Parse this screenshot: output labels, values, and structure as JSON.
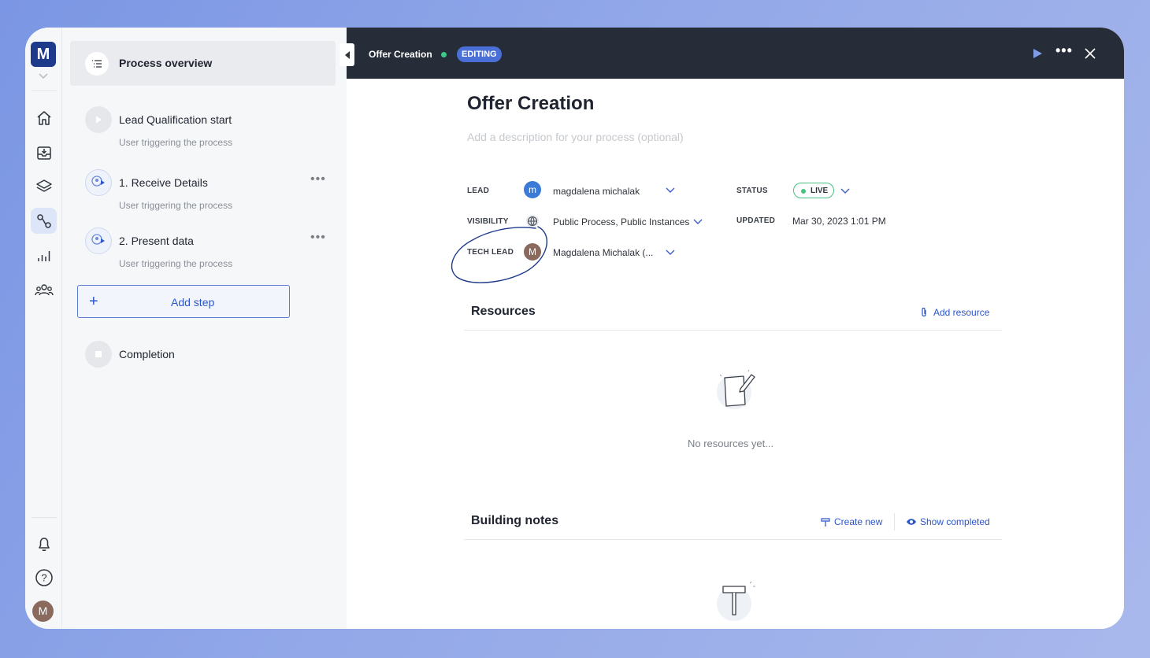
{
  "rail": {
    "logo_letter": "M",
    "avatar_letter": "M",
    "icons": [
      "home-icon",
      "inbox-icon",
      "layers-icon",
      "process-icon",
      "analytics-icon",
      "team-icon",
      "bell-icon",
      "help-icon"
    ]
  },
  "steps_panel": {
    "overview_label": "Process overview",
    "steps": [
      {
        "title": "Lead Qualification start",
        "subtitle": "User triggering the process"
      },
      {
        "title": "1. Receive Details",
        "subtitle": "User triggering the process",
        "more": "•••"
      },
      {
        "title": "2. Present data",
        "subtitle": "User triggering the process",
        "more": "•••"
      }
    ],
    "add_step_label": "Add step",
    "add_step_plus": "+",
    "completion_label": "Completion"
  },
  "topbar": {
    "title": "Offer Creation",
    "badge": "EDITING",
    "more": "•••"
  },
  "process": {
    "title": "Offer Creation",
    "description_placeholder": "Add a description for your process (optional)",
    "lead_label": "LEAD",
    "lead_avatar": "m",
    "lead_value": "magdalena michalak",
    "visibility_label": "VISIBILITY",
    "visibility_value": "Public Process, Public Instances",
    "tech_lead_label": "TECH LEAD",
    "tech_lead_avatar": "M",
    "tech_lead_value": "Magdalena Michalak (...",
    "status_label": "STATUS",
    "status_value": "LIVE",
    "updated_label": "UPDATED",
    "updated_value": "Mar 30, 2023 1:01 PM"
  },
  "resources": {
    "title": "Resources",
    "add_label": "Add resource",
    "empty_text": "No resources yet..."
  },
  "notes": {
    "title": "Building notes",
    "create_label": "Create new",
    "show_completed_label": "Show completed"
  },
  "colors": {
    "accent": "#2b56c9",
    "topbar_bg": "#272d38",
    "live_green": "#47c181",
    "badge_blue": "#4a6fd6",
    "annotation_ink": "#1e3a8a"
  }
}
